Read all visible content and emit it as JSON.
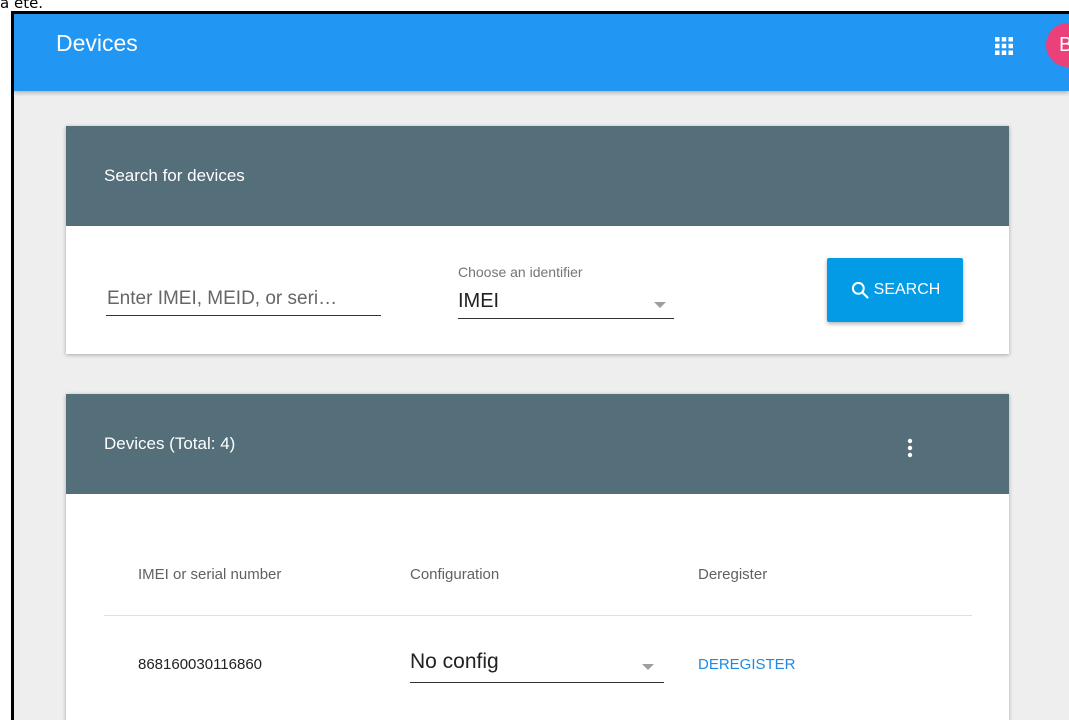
{
  "top_text": "a été.",
  "app_bar": {
    "title": "Devices",
    "apps_icon": "apps-grid-icon",
    "avatar_letter": "B",
    "color": "#2196f3",
    "avatar_color": "#ec407a"
  },
  "search_card": {
    "title": "Search for devices",
    "input_placeholder": "Enter IMEI, MEID, or seri…",
    "select_label": "Choose an identifier",
    "select_value": "IMEI",
    "search_button_label": "SEARCH",
    "search_icon": "search-icon",
    "header_color": "#546e7a",
    "button_color": "#039be5"
  },
  "devices_card": {
    "title": "Devices (Total: 4)",
    "more_icon": "more-vert-icon",
    "columns": [
      "IMEI or serial number",
      "Configuration",
      "Deregister"
    ],
    "rows": [
      {
        "imei": "868160030116860",
        "configuration": "No config",
        "action": "DEREGISTER"
      }
    ],
    "link_color": "#1e88e5"
  }
}
